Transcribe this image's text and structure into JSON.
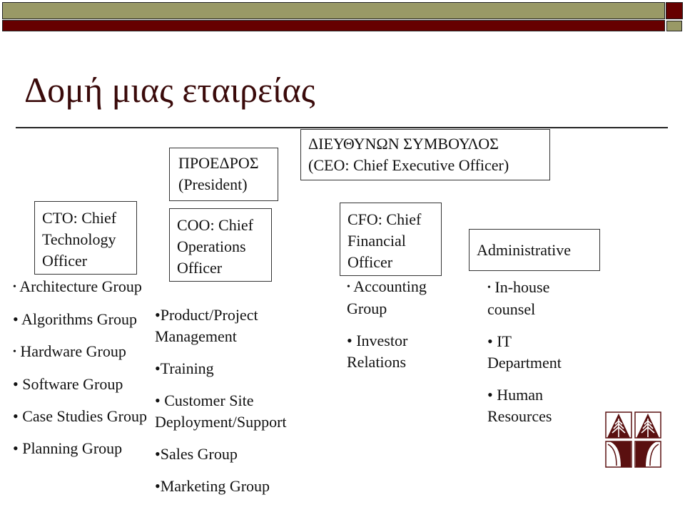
{
  "header": {
    "colors": {
      "olive": "#999966",
      "dark_red": "#660000",
      "title": "#3a0a0a"
    }
  },
  "title": "Δομή μιας εταιρείας",
  "president": {
    "line1": "ΠΡΟΕΔΡΟΣ",
    "line2": "(President)"
  },
  "ceo": {
    "line1": "ΔΙΕΥΘΥΝΩΝ ΣΥΜΒΟΥΛΟΣ",
    "line2": "(CEO: Chief Executive Officer)"
  },
  "cto": {
    "lines": [
      "CTO: Chief",
      "Technology",
      "Officer"
    ],
    "items": [
      "Architecture Group",
      "Algorithms Group",
      "Hardware Group",
      "Software Group",
      "Case Studies Group",
      "Planning Group"
    ]
  },
  "coo": {
    "lines": [
      "COO: Chief",
      "Operations",
      "Officer"
    ],
    "items": [
      "Product/Project Management",
      "Training",
      "Customer Site Deployment/Support",
      "Sales Group",
      "Marketing Group"
    ]
  },
  "cfo": {
    "lines": [
      "CFO: Chief",
      "Financial",
      "Officer"
    ],
    "items": [
      "Accounting Group",
      "Investor Relations"
    ]
  },
  "admin": {
    "label": "Administrative",
    "items": [
      "In-house counsel",
      "IT Department",
      "Human Resources"
    ]
  },
  "logo": {
    "icon": "university-tree-logo",
    "color": "#5a1010"
  }
}
